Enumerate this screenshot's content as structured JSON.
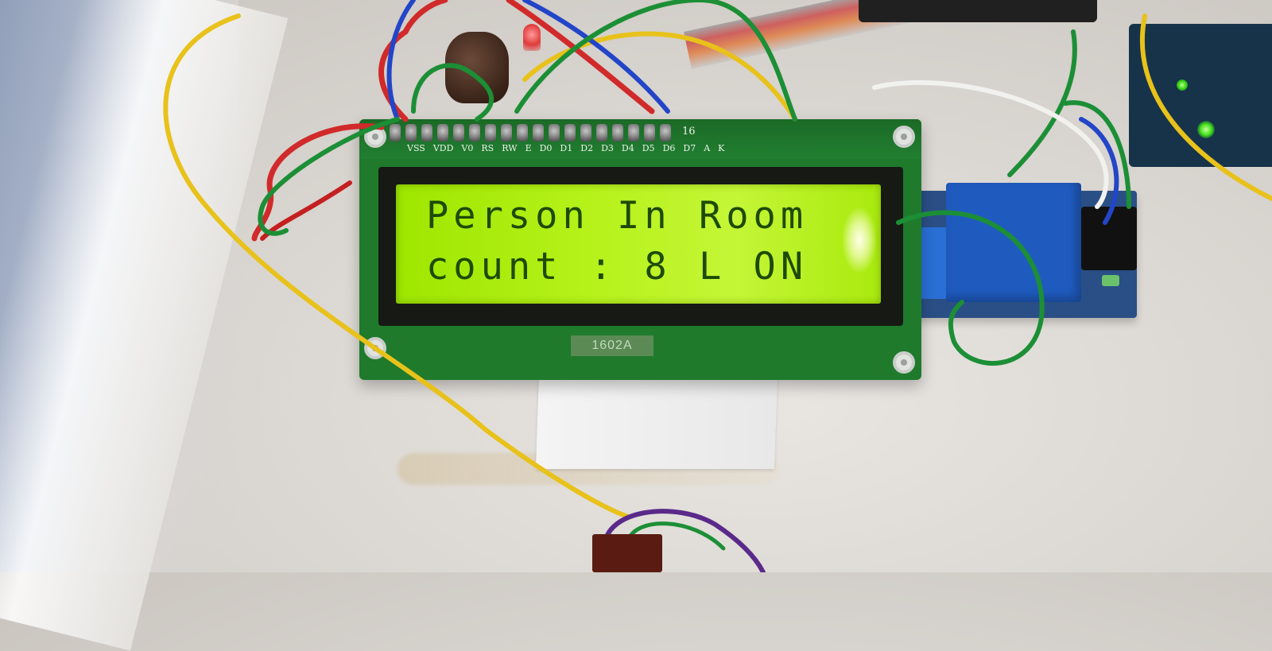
{
  "lcd": {
    "line1": "Person In Room",
    "line2": "count : 8 L ON"
  },
  "board": {
    "model_label": "1602A",
    "pin_labels": [
      "VSS",
      "VDD",
      "V0",
      "RS",
      "RW",
      "E",
      "D0",
      "D1",
      "D2",
      "D3",
      "D4",
      "D5",
      "D6",
      "D7",
      "A",
      "K"
    ],
    "pin_count_label": "16"
  },
  "colors": {
    "lcd_backlight": "#b6f21a",
    "lcd_text": "#1e4a05",
    "pcb_green": "#1f7a2c",
    "relay_blue": "#1f5bbf",
    "wire_yellow": "#e8c21a",
    "wire_red": "#d12a2a",
    "wire_green": "#1c8f36",
    "wire_blue": "#2345c8",
    "wire_purple": "#5a2a8a"
  }
}
